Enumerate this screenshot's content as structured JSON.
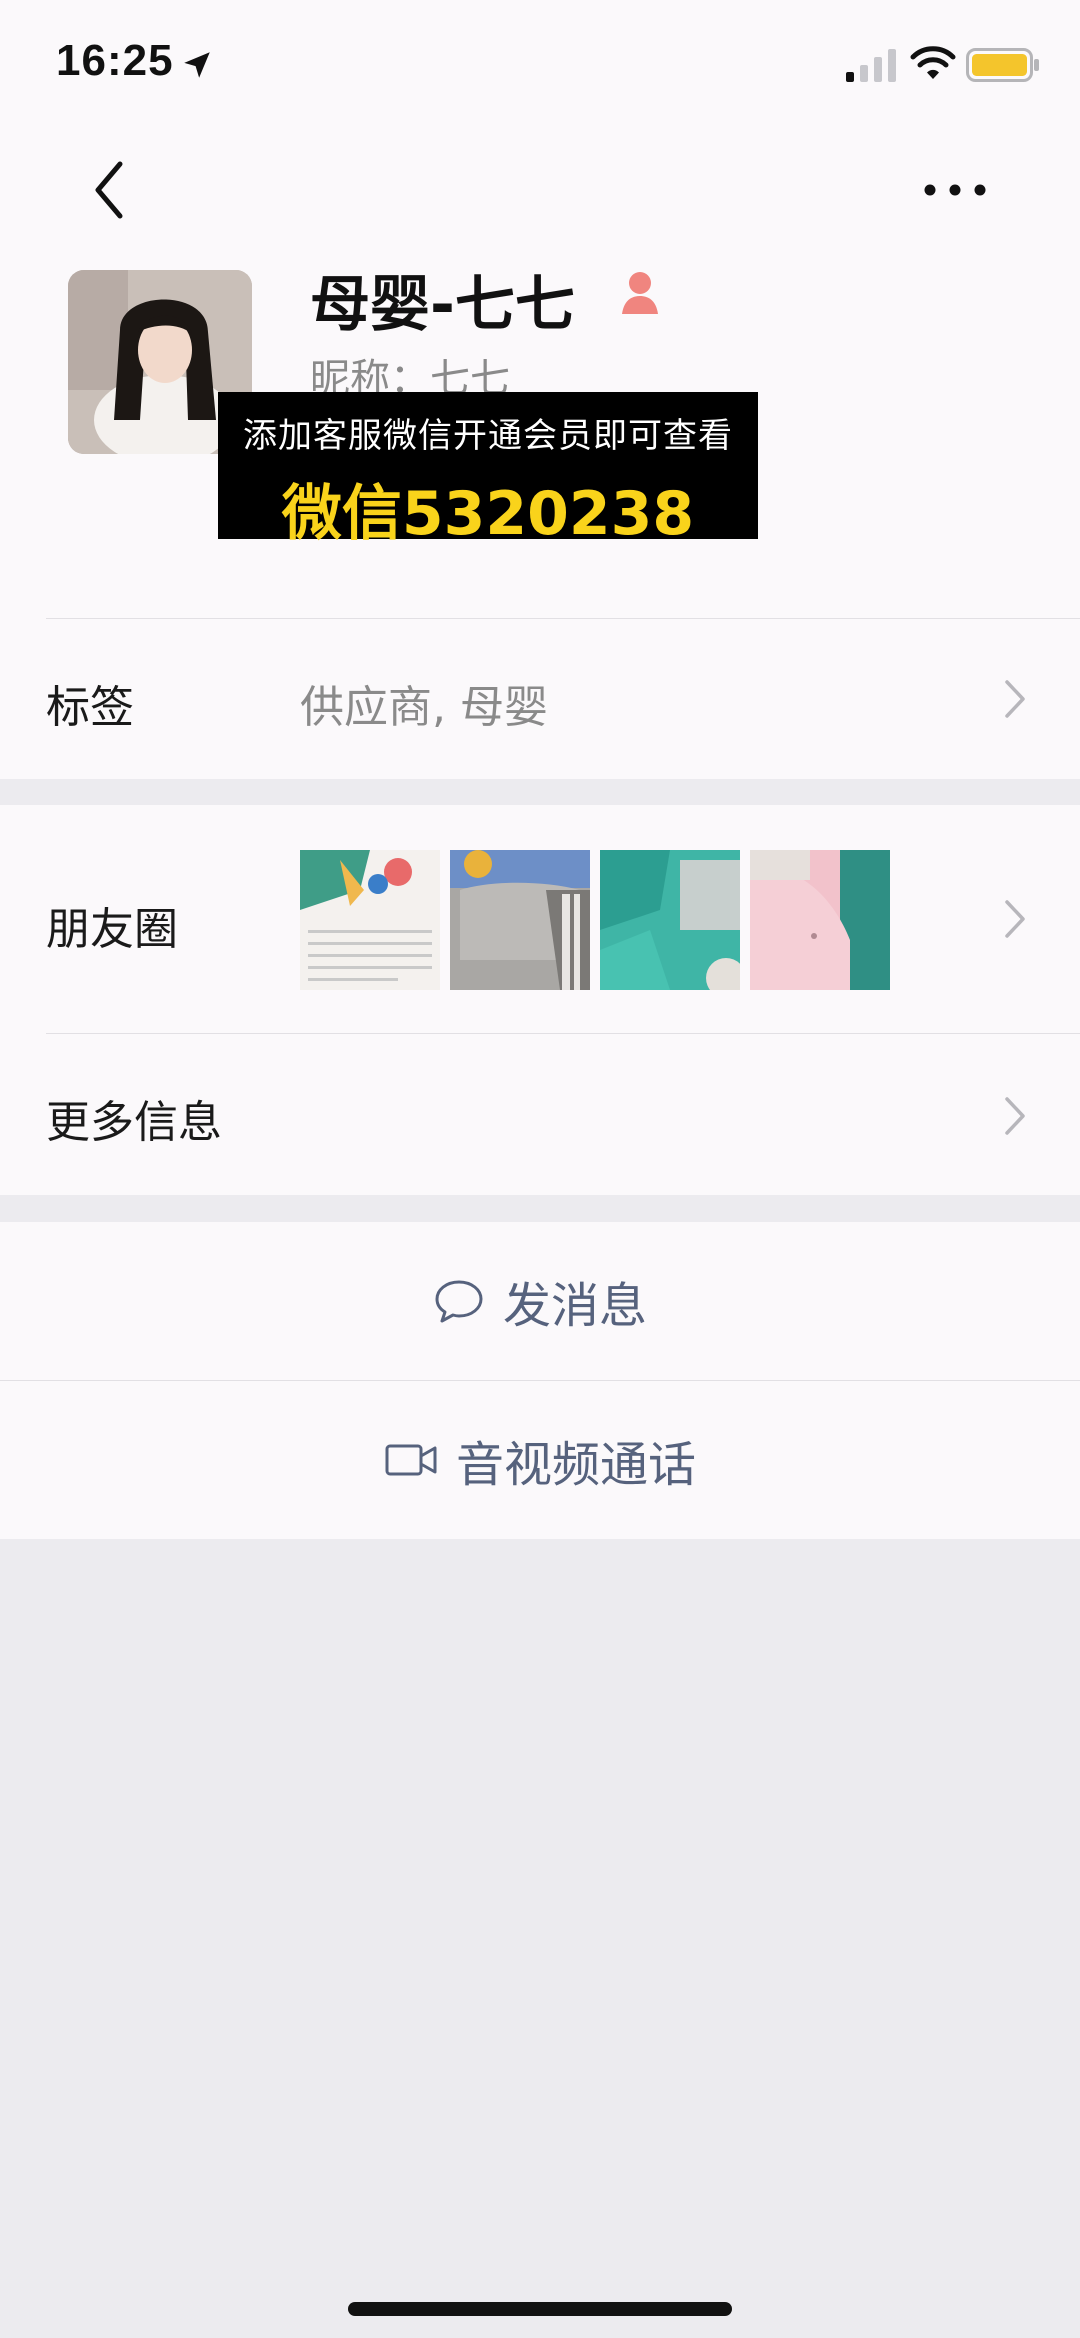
{
  "status_bar": {
    "time": "16:25"
  },
  "nav": {
    "back_icon": "chevron-left-icon",
    "more_icon": "more-dots-icon"
  },
  "profile": {
    "name": "母婴-七七",
    "nickname": "昵称：七七",
    "gender_icon": "female-user-icon"
  },
  "promo": {
    "line1": "添加客服微信开通会员即可查看",
    "line2": "微信5320238"
  },
  "rows": {
    "tags": {
      "label": "标签",
      "value": "供应商, 母婴"
    },
    "moments": {
      "label": "朋友圈"
    },
    "more_info": {
      "label": "更多信息"
    }
  },
  "actions": {
    "message": {
      "label": "发消息",
      "icon": "chat-bubble-icon"
    },
    "call": {
      "label": "音视频通话",
      "icon": "video-camera-icon"
    }
  },
  "colors": {
    "accent_link": "#56627d",
    "promo_yellow": "#f9d31b",
    "background": "#ecebef",
    "card": "#fbf9fb"
  }
}
